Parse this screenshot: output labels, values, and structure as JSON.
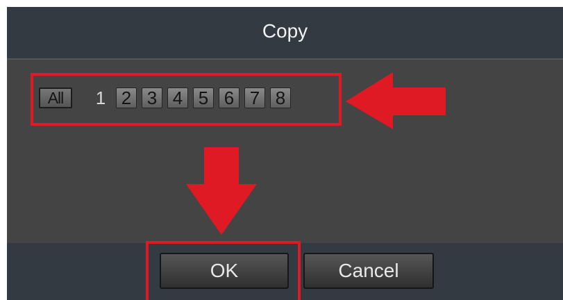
{
  "dialog": {
    "title": "Copy",
    "all_label": "All",
    "channels": [
      "1",
      "2",
      "3",
      "4",
      "5",
      "6",
      "7",
      "8"
    ]
  },
  "buttons": {
    "ok_label": "OK",
    "cancel_label": "Cancel"
  },
  "colors": {
    "title_bar": "#343a42",
    "panel": "#444444",
    "highlight": "#e01a24"
  }
}
